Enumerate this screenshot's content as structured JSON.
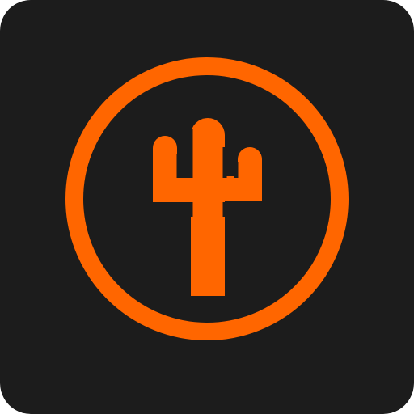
{
  "icon": {
    "name": "cactus-app-icon",
    "glyph": "cactus-icon",
    "background_color": "#1c1c1c",
    "accent_color": "#ff6600"
  }
}
